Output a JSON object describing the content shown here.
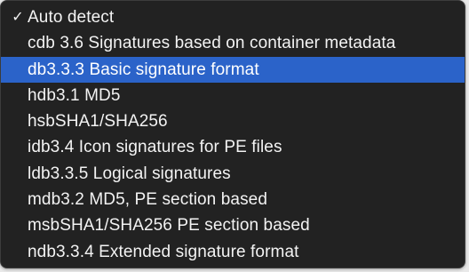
{
  "menu": {
    "items": [
      {
        "label": "Auto detect",
        "checked": true
      },
      {
        "label": "cdb 3.6 Signatures based on container metadata"
      },
      {
        "label": "db3.3.3 Basic signature format",
        "selected": true
      },
      {
        "label": "hdb3.1 MD5"
      },
      {
        "label": "hsbSHA1/SHA256"
      },
      {
        "label": "idb3.4 Icon signatures for PE files"
      },
      {
        "label": "ldb3.3.5 Logical signatures"
      },
      {
        "label": "mdb3.2 MD5, PE section based"
      },
      {
        "label": "msbSHA1/SHA256 PE section based"
      },
      {
        "label": "ndb3.3.4 Extended signature format"
      }
    ],
    "checkmark_glyph": "✓"
  },
  "colors": {
    "menu_background": "#222222",
    "highlight": "#2b63c9",
    "text": "#f3f3f3"
  }
}
